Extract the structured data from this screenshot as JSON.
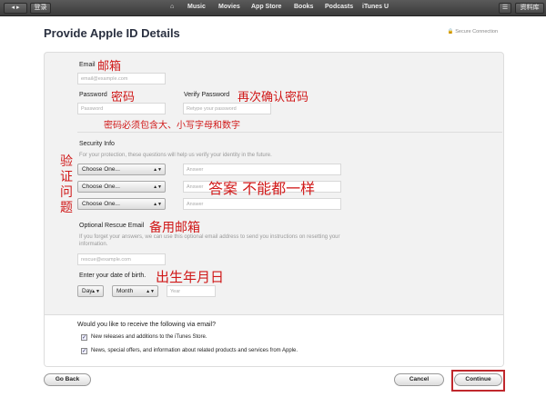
{
  "topbar": {
    "login": "登录",
    "nav": [
      "Music",
      "Movies",
      "App Store",
      "Books",
      "Podcasts",
      "iTunes U"
    ],
    "library": "资料库"
  },
  "page": {
    "title": "Provide Apple ID Details",
    "secure": "Secure Connection"
  },
  "form": {
    "email_label": "Email",
    "email_placeholder": "email@example.com",
    "password_label": "Password",
    "password_placeholder": "Password",
    "verify_label": "Verify Password",
    "verify_placeholder": "Retype your password",
    "security_title": "Security Info",
    "security_desc": "For your protection, these questions will help us verify your identity in the future.",
    "questions": [
      {
        "select": "Choose One...",
        "answer": "Answer"
      },
      {
        "select": "Choose One...",
        "answer": "Answer"
      },
      {
        "select": "Choose One...",
        "answer": "Answer"
      }
    ],
    "rescue_label": "Optional Rescue Email",
    "rescue_desc": "If you forget your answers, we can use this optional email address to send you instructions on resetting your information.",
    "rescue_placeholder": "rescue@example.com",
    "dob_label": "Enter your date of birth.",
    "day": "Day",
    "month": "Month",
    "year_placeholder": "Year",
    "email_question": "Would you like to receive the following via email?",
    "checkboxes": [
      {
        "label": "New releases and additions to the iTunes Store.",
        "checked": true
      },
      {
        "label": "News, special offers, and information about related products and services from Apple.",
        "checked": true
      }
    ]
  },
  "annotations": {
    "email": "邮箱",
    "password": "密码",
    "verify": "再次确认密码",
    "password_rule": "密码必须包含大、小写字母和数字",
    "security": "验证问题",
    "answers": "答案 不能都一样",
    "rescue": "备用邮箱",
    "dob": "出生年月日",
    "color": "#d01818"
  },
  "buttons": {
    "go_back": "Go Back",
    "cancel": "Cancel",
    "continue": "Continue"
  }
}
